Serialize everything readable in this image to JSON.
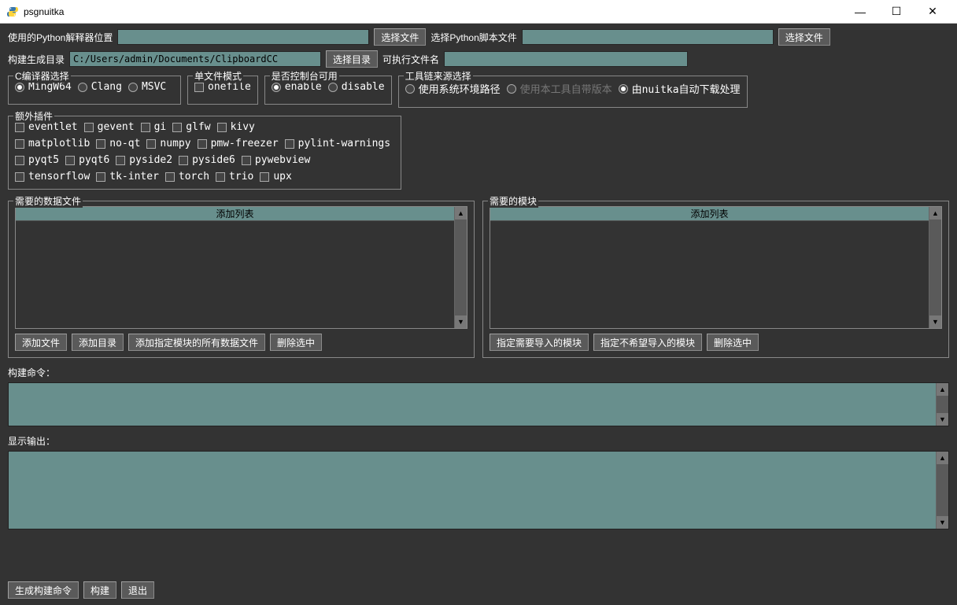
{
  "window": {
    "title": "psgnuitka"
  },
  "row1": {
    "python_path_label": "使用的Python解释器位置",
    "python_path_value": "",
    "choose_file1": "选择文件",
    "script_label": "选择Python脚本文件",
    "script_value": "",
    "choose_file2": "选择文件"
  },
  "row2": {
    "build_dir_label": "构建生成目录",
    "build_dir_value": "C:/Users/admin/Documents/ClipboardCC",
    "choose_dir": "选择目录",
    "exe_name_label": "可执行文件名",
    "exe_name_value": ""
  },
  "compiler": {
    "legend": "C编译器选择",
    "options": [
      "MingW64",
      "Clang",
      "MSVC"
    ],
    "selected": "MingW64"
  },
  "onefile": {
    "legend": "单文件模式",
    "label": "onefile"
  },
  "console": {
    "legend": "是否控制台可用",
    "options": [
      "enable",
      "disable"
    ],
    "selected": "enable"
  },
  "toolchain": {
    "legend": "工具链来源选择",
    "options": [
      "使用系统环境路径",
      "使用本工具自带版本",
      "由nuitka自动下载处理"
    ],
    "selected": "由nuitka自动下载处理",
    "disabled": "使用本工具自带版本"
  },
  "plugins": {
    "legend": "额外插件",
    "row1": [
      "eventlet",
      "gevent",
      "gi",
      "glfw",
      "kivy"
    ],
    "row2": [
      "matplotlib",
      "no-qt",
      "numpy",
      "pmw-freezer",
      "pylint-warnings"
    ],
    "row3": [
      "pyqt5",
      "pyqt6",
      "pyside2",
      "pyside6",
      "pywebview"
    ],
    "row4": [
      "tensorflow",
      "tk-inter",
      "torch",
      "trio",
      "upx"
    ]
  },
  "datafiles": {
    "legend": "需要的数据文件",
    "header": "添加列表",
    "btn_add_file": "添加文件",
    "btn_add_dir": "添加目录",
    "btn_add_module_data": "添加指定模块的所有数据文件",
    "btn_delete": "删除选中"
  },
  "modules": {
    "legend": "需要的模块",
    "header": "添加列表",
    "btn_import": "指定需要导入的模块",
    "btn_noimport": "指定不希望导入的模块",
    "btn_delete": "删除选中"
  },
  "build_cmd_label": "构建命令：",
  "output_label": "显示输出：",
  "bottom": {
    "gen_cmd": "生成构建命令",
    "build": "构建",
    "exit": "退出"
  }
}
